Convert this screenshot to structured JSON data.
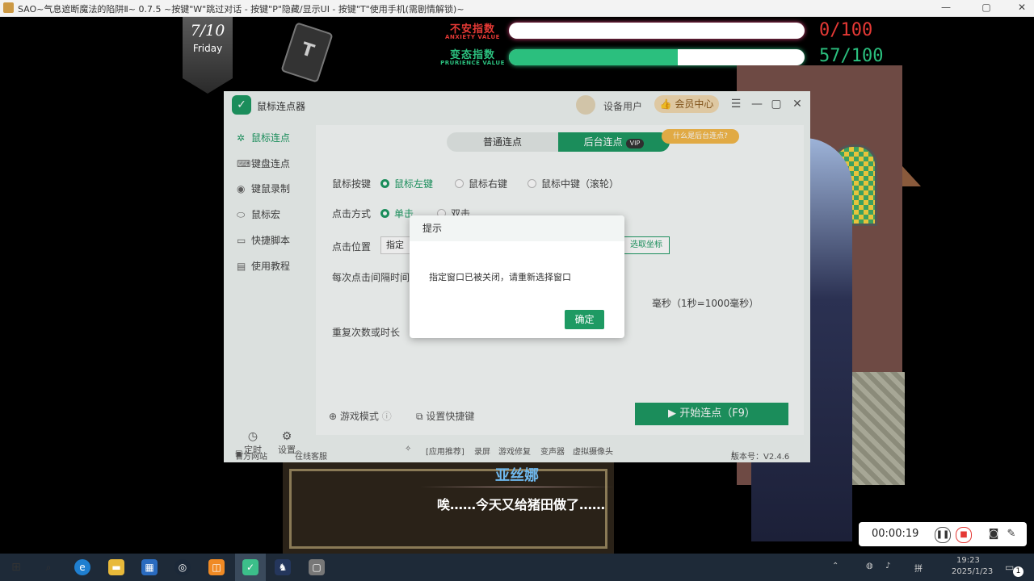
{
  "window": {
    "title": "SAO~气息遮断魔法的陷阱Ⅱ~ 0.7.5 ~按键\"W\"跳过对话 - 按键\"P\"隐藏/显示UI - 按键\"T\"使用手机(需剧情解锁)~"
  },
  "hud": {
    "date": "7/10",
    "day": "Friday",
    "phone_letter": "T",
    "anxiety": {
      "label_cn": "不安指数",
      "label_en": "ANXIETY VALUE",
      "value_text": "0/100",
      "value": 0,
      "max": 100,
      "color": "#e53935"
    },
    "prurience": {
      "label_cn": "变态指数",
      "label_en": "PRURIENCE VALUE",
      "value_text": "57/100",
      "value": 57,
      "max": 100,
      "color": "#2bbf7e"
    }
  },
  "dialog": {
    "speaker": "亚丝娜",
    "text": "唉……今天又给猪田做了……"
  },
  "app": {
    "name": "鼠标连点器",
    "user_name": "设备用户",
    "vip_center": "会员中心",
    "sidebar": [
      {
        "label": "鼠标连点",
        "icon": "cursor-click-icon"
      },
      {
        "label": "键盘连点",
        "icon": "keyboard-icon"
      },
      {
        "label": "键鼠录制",
        "icon": "record-icon"
      },
      {
        "label": "鼠标宏",
        "icon": "mouse-icon"
      },
      {
        "label": "快捷脚本",
        "icon": "script-icon"
      },
      {
        "label": "使用教程",
        "icon": "tutorial-icon"
      }
    ],
    "sidebar_bottom": {
      "timer": "定时",
      "settings": "设置"
    },
    "tabs": {
      "normal": "普通连点",
      "background": "后台连点",
      "vip_badge": "VIP",
      "tip": "什么是后台连点?"
    },
    "mouse_button": {
      "label": "鼠标按键",
      "options": [
        "鼠标左键",
        "鼠标右键",
        "鼠标中键（滚轮）"
      ]
    },
    "click_mode": {
      "label": "点击方式",
      "options": [
        "单击",
        "双击"
      ]
    },
    "click_position": {
      "label": "点击位置",
      "select_value": "指定",
      "pick_button": "选取坐标"
    },
    "interval": {
      "label": "每次点击间隔时间",
      "unit_text": "毫秒（1秒=1000毫秒）"
    },
    "repeat": {
      "label": "重复次数或时长"
    },
    "game_mode": "游戏模式",
    "set_hotkey": "设置快捷键",
    "start_button": "开始连点（F9）",
    "footer": {
      "website": "官方网站",
      "online_service": "在线客服",
      "recommend": "[应用推荐]",
      "links": [
        "录屏",
        "游戏修复",
        "变声器",
        "虚拟摄像头"
      ],
      "version": "版本号：V2.4.6"
    }
  },
  "modal": {
    "title": "提示",
    "message": "指定窗口已被关闭，请重新选择窗口",
    "ok": "确定"
  },
  "recorder": {
    "time": "00:00:19"
  },
  "tray": {
    "time": "19:23",
    "date": "2025/1/23",
    "ime": "拼",
    "notify_count": "1"
  }
}
